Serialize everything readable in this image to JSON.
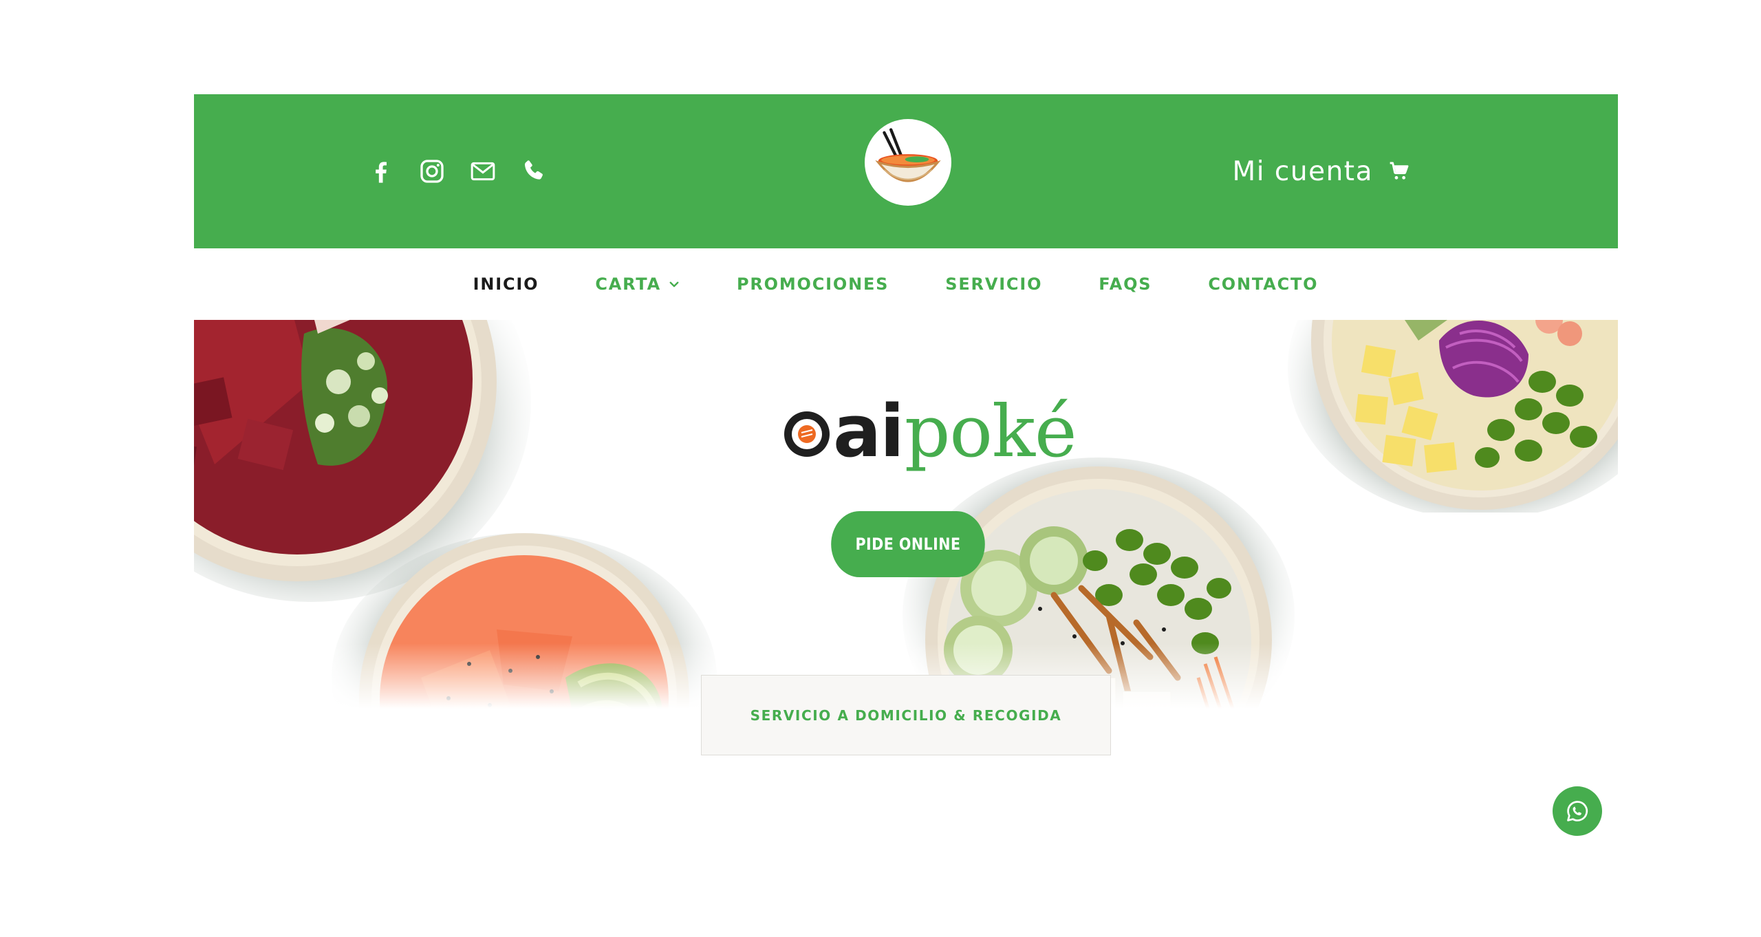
{
  "colors": {
    "brand_green": "#46ad4e",
    "nav_active": "#1b1b1b",
    "background": "#ffffff"
  },
  "header": {
    "social_icons": [
      "facebook-icon",
      "instagram-icon",
      "mail-icon",
      "phone-icon"
    ],
    "logo_icon": "poke-bowl-chopsticks-logo",
    "account_label": "Mi cuenta",
    "cart_icon": "cart-icon"
  },
  "nav": {
    "items": [
      {
        "label": "INICIO",
        "active": true
      },
      {
        "label": "CARTA",
        "has_dropdown": true
      },
      {
        "label": "PROMOCIONES"
      },
      {
        "label": "SERVICIO"
      },
      {
        "label": "FAQS"
      },
      {
        "label": "CONTACTO"
      }
    ]
  },
  "hero": {
    "brand_left": "ai",
    "brand_right": "poké",
    "cta_label": "PIDE ONLINE"
  },
  "service": {
    "label": "SERVICIO A DOMICILIO & RECOGIDA"
  },
  "floating": {
    "whatsapp_icon": "whatsapp-icon"
  }
}
